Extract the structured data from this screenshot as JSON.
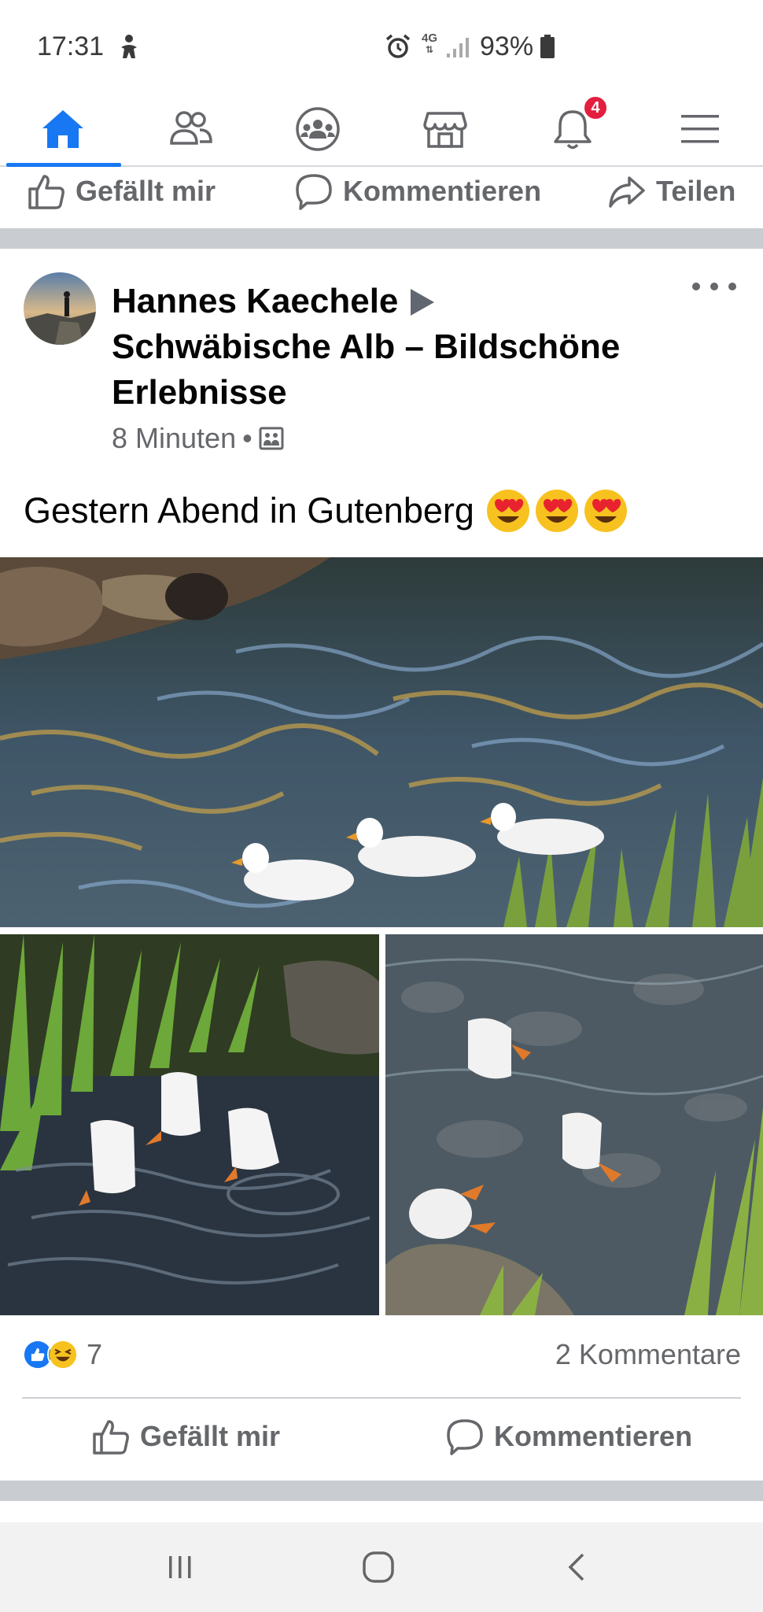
{
  "status_bar": {
    "time": "17:31",
    "network_type": "4G",
    "battery_percent": "93%"
  },
  "nav": {
    "items": [
      {
        "name": "home",
        "icon": "home-icon",
        "active": true
      },
      {
        "name": "friends",
        "icon": "friends-icon",
        "active": false
      },
      {
        "name": "groups",
        "icon": "groups-icon",
        "active": false
      },
      {
        "name": "marketplace",
        "icon": "marketplace-icon",
        "active": false
      },
      {
        "name": "notifications",
        "icon": "bell-icon",
        "active": false
      },
      {
        "name": "menu",
        "icon": "hamburger-menu-icon",
        "active": false
      }
    ],
    "notification_badge": "4",
    "accent_color": "#1877f2",
    "badge_color": "#e41e3f"
  },
  "previous_post_actions": {
    "like_label": "Gefällt mir",
    "comment_label": "Kommentieren",
    "share_label": "Teilen"
  },
  "post": {
    "author": "Hannes Kaechele",
    "group": "Schwäbische Alb – Bildschöne Erlebnisse",
    "time": "8 Minuten",
    "separator": "•",
    "audience_icon": "group-photo-icon",
    "text": "Gestern Abend in Gutenberg",
    "emoji_icons": [
      "heart-eyes-emoji",
      "heart-eyes-emoji",
      "heart-eyes-emoji"
    ],
    "photos": [
      {
        "name": "photo-ducks-swimming"
      },
      {
        "name": "photo-ducks-diving-grass"
      },
      {
        "name": "photo-ducks-diving-stream"
      }
    ],
    "reactions": {
      "icons": [
        "like-reaction-icon",
        "haha-reaction-icon"
      ],
      "count": "7"
    },
    "comments_count_label": "2 Kommentare",
    "actions": {
      "like_label": "Gefällt mir",
      "comment_label": "Kommentieren"
    }
  },
  "system_nav": {
    "icons": [
      "recent-apps-icon",
      "home-circle-icon",
      "back-icon"
    ]
  }
}
